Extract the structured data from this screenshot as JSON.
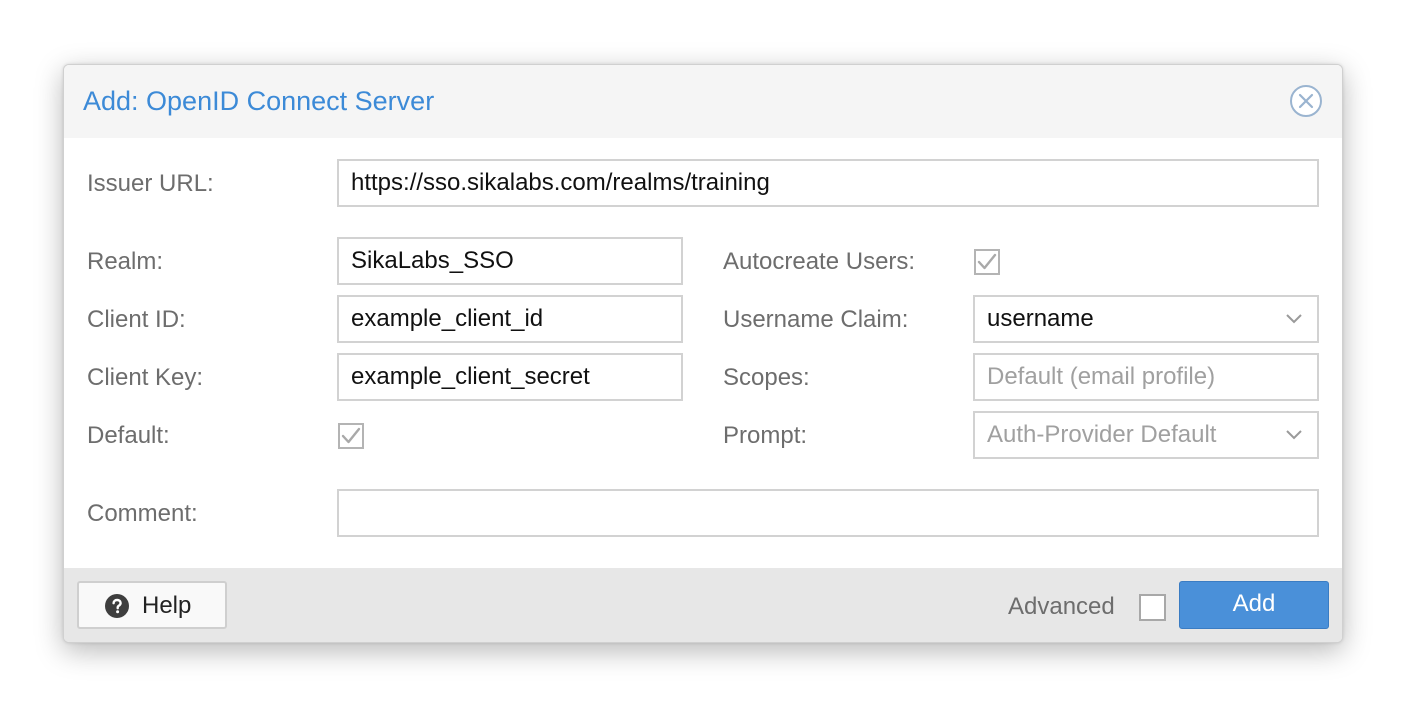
{
  "dialog": {
    "title": "Add: OpenID Connect Server",
    "close_icon": "close-circle-icon"
  },
  "form": {
    "issuer_url": {
      "label": "Issuer URL:",
      "value": "https://sso.sikalabs.com/realms/training"
    },
    "realm": {
      "label": "Realm:",
      "value": "SikaLabs_SSO"
    },
    "client_id": {
      "label": "Client ID:",
      "value": "example_client_id"
    },
    "client_key": {
      "label": "Client Key:",
      "value": "example_client_secret"
    },
    "default": {
      "label": "Default:",
      "checked": true
    },
    "autocreate_users": {
      "label": "Autocreate Users:",
      "checked": true
    },
    "username_claim": {
      "label": "Username Claim:",
      "value": "username"
    },
    "scopes": {
      "label": "Scopes:",
      "value": "",
      "placeholder": "Default (email profile)"
    },
    "prompt": {
      "label": "Prompt:",
      "value": "Auth-Provider Default"
    },
    "comment": {
      "label": "Comment:",
      "value": ""
    }
  },
  "footer": {
    "help_label": "Help",
    "help_icon": "question-circle-icon",
    "advanced_label": "Advanced",
    "advanced_checked": false,
    "add_label": "Add"
  },
  "colors": {
    "accent": "#3c8ad7",
    "primary_button": "#4a90d9",
    "title_bar": "#f5f5f5",
    "footer_bar": "#e7e7e7",
    "label_text": "#6d6d6d",
    "field_border": "#d2d2d2"
  }
}
